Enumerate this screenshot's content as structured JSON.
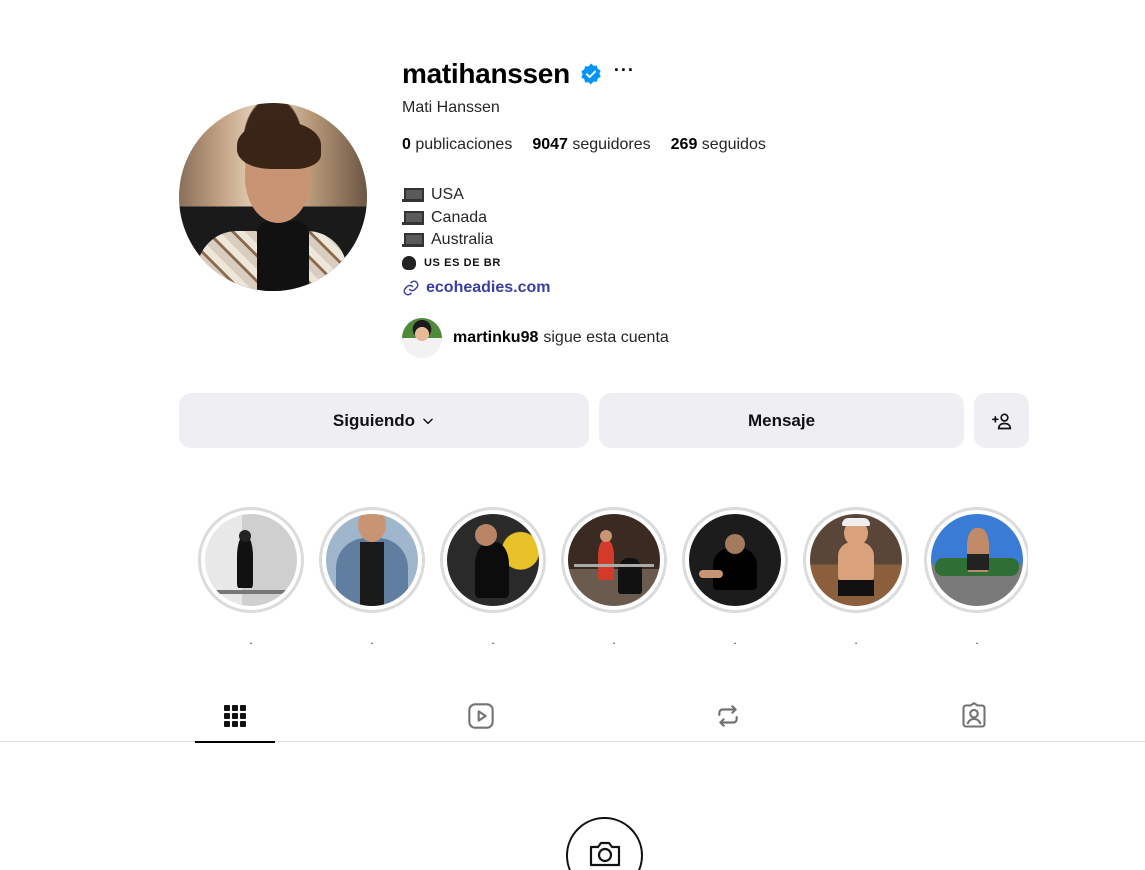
{
  "profile": {
    "username": "matihanssen",
    "verified_icon": "verified-badge-icon",
    "more_label": "···",
    "full_name": "Mati Hanssen",
    "stats": [
      {
        "count": "0",
        "label": "publicaciones"
      },
      {
        "count": "9047",
        "label": "seguidores"
      },
      {
        "count": "269",
        "label": "seguidos"
      }
    ],
    "bio": [
      {
        "icon": "laptop-icon",
        "text": "USA"
      },
      {
        "icon": "laptop-icon",
        "text": "Canada"
      },
      {
        "icon": "laptop-icon",
        "text": "Australia"
      },
      {
        "icon": "speaking-head-icon",
        "text": "US ES DE BR"
      }
    ],
    "link": {
      "icon": "link-icon",
      "text": "ecoheadies.com"
    },
    "followed_by": {
      "username": "martinku98",
      "text": "sigue esta cuenta"
    }
  },
  "actions": {
    "following_label": "Siguiendo",
    "message_label": "Mensaje",
    "add_icon": "add-person-icon"
  },
  "highlights": [
    {
      "label": "."
    },
    {
      "label": "."
    },
    {
      "label": "."
    },
    {
      "label": "."
    },
    {
      "label": "."
    },
    {
      "label": "."
    },
    {
      "label": "."
    }
  ],
  "tabs": [
    {
      "icon": "grid-icon",
      "active": true
    },
    {
      "icon": "reels-icon",
      "active": false
    },
    {
      "icon": "reposts-icon",
      "active": false
    },
    {
      "icon": "tagged-icon",
      "active": false
    }
  ],
  "empty_state": {
    "icon": "camera-icon"
  },
  "colors": {
    "link": "#3a3fa0",
    "verified": "#0095f6",
    "button_bg": "#efeff3"
  }
}
